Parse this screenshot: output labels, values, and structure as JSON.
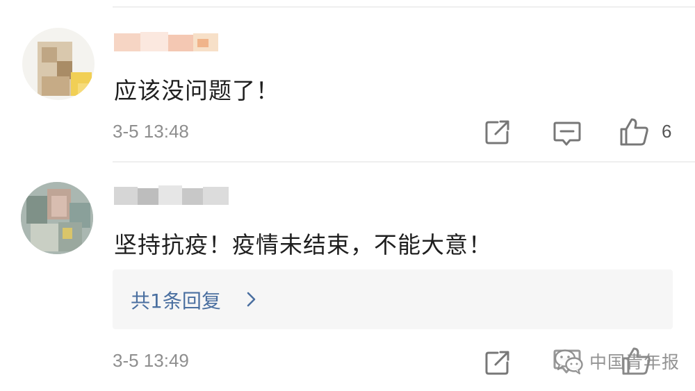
{
  "comments": [
    {
      "text": "应该没问题了！",
      "time": "3-5 13:48",
      "likes": "6"
    },
    {
      "text": "坚持抗疫！疫情未结束，不能大意！",
      "time": "3-5 13:49",
      "reply_label": "共1条回复"
    }
  ],
  "watermark": {
    "text": "中国青年报"
  },
  "icons": {
    "share": "share-icon",
    "comment": "comment-icon",
    "like": "thumbs-up-icon",
    "chevron": "chevron-right-icon",
    "watermark": "wechat-icon"
  },
  "colors": {
    "reply_link": "#4a6fa0",
    "meta_text": "#8e8e8e",
    "reply_bg": "#f6f6f6"
  }
}
